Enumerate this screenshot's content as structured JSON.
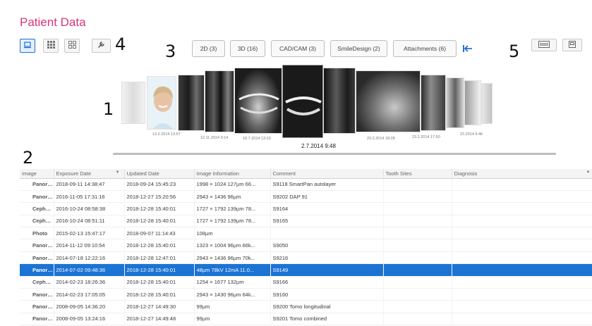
{
  "page": {
    "title": "Patient Data"
  },
  "callouts": [
    "1",
    "2",
    "3",
    "4",
    "5"
  ],
  "toolbar": {
    "view_modes": [
      {
        "name": "filmstrip-view",
        "icon": "filmstrip-icon",
        "active": true
      },
      {
        "name": "grid-view",
        "icon": "grid-icon",
        "active": false
      },
      {
        "name": "large-grid-view",
        "icon": "large-grid-icon",
        "active": false
      }
    ],
    "tool_icon": "wrench-icon",
    "categories": [
      {
        "label": "2D (3)"
      },
      {
        "label": "3D (16)"
      },
      {
        "label": "CAD/CAM (3)"
      },
      {
        "label": "SmileDesign (2)"
      },
      {
        "label": "Attachments (6)"
      }
    ],
    "back_icon": "jump-to-start-icon",
    "right_icons": [
      "panel-layout-icon",
      "window-icon"
    ]
  },
  "filmstrip": {
    "date_labels": [
      "13.2.2014 13:57",
      "12.11.2014 9:14",
      "18.7.2014 13:33",
      "27.2014 9:48",
      "23.2.2014 18:28",
      "23.2.2014 17:50",
      "23.2014 9:46"
    ],
    "selected_date": "2.7.2014 9:48"
  },
  "table": {
    "columns": [
      "Image",
      "Exposure Date",
      "Updated Date",
      "Image Information",
      "Comment",
      "Tooth Sites",
      "Diagnosis"
    ],
    "sort_indicator": "▼",
    "menu_indicator": "▼",
    "selected_row": 7,
    "rows": [
      [
        "Panoramic",
        "2018-09-11 14:38:47",
        "2018-09-24 15:45:23",
        "1998 × 1024 127µm 66...",
        "S9118 SmartPan autolayer",
        "",
        ""
      ],
      [
        "Panoramic",
        "2016-11-05 17:31:16",
        "2018-12-27 15:20:56",
        "2943 × 1436 96µm",
        "S9202 DAP 91",
        "",
        ""
      ],
      [
        "Cephalome...",
        "2016-10-24 08:58:38",
        "2018-12-28 15:40:01",
        "1727 × 1792 139µm 78...",
        "S9164",
        "",
        ""
      ],
      [
        "Cephalome...",
        "2016-10-24 08:51:11",
        "2018-12-28 15:40:01",
        "1727 × 1792 139µm 78...",
        "S9165",
        "",
        ""
      ],
      [
        "Photo",
        "2015-02-13 15:47:17",
        "2018-09-07 11:14:43",
        "108µm",
        "",
        "",
        ""
      ],
      [
        "Panoramic",
        "2014-11-12 09:10:54",
        "2018-12-28 15:40:01",
        "1323 × 1004 96µm 66k...",
        "S9050",
        "",
        ""
      ],
      [
        "Panoramic",
        "2014-07-18 12:22:16",
        "2018-12-28 12:47:01",
        "2943 × 1436 96µm 70k...",
        "S9216",
        "",
        ""
      ],
      [
        "Panoramic",
        "2014-07-02 09:48:36",
        "2018-12-28 15:40:01",
        "48µm 78kV 12mA 11.0...",
        "S9149",
        "",
        ""
      ],
      [
        "Cephalome...",
        "2014-02-23 18:26:36",
        "2018-12-28 15:40:01",
        "1254 × 1677 132µm",
        "S9166",
        "",
        ""
      ],
      [
        "Panoramic",
        "2014-02-23 17:05:05",
        "2018-12-28 15:40:01",
        "2943 × 1430 96µm 64k...",
        "S9160",
        "",
        ""
      ],
      [
        "Panoramic",
        "2008-09-05 14:36:20",
        "2018-12-27 14:49:30",
        "99µm",
        "S9200 Tomo longitudinal",
        "",
        ""
      ],
      [
        "Panoramic",
        "2008-09-05 13:24:16",
        "2018-12-27 14:49:48",
        "99µm",
        "S9201 Tomo combined",
        "",
        ""
      ]
    ]
  }
}
